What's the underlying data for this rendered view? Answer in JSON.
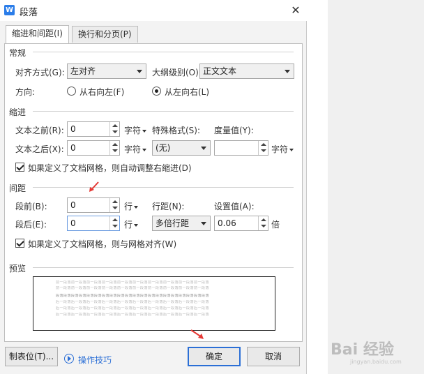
{
  "window": {
    "title": "段落",
    "app_icon": "W"
  },
  "tabs": [
    {
      "label": "缩进和间距(I)",
      "active": true
    },
    {
      "label": "换行和分页(P)",
      "active": false
    }
  ],
  "general": {
    "section_title": "常规",
    "alignment_label": "对齐方式(G):",
    "alignment_value": "左对齐",
    "outline_label": "大纲级别(O):",
    "outline_value": "正文文本",
    "direction_label": "方向:",
    "direction_rtl": "从右向左(F)",
    "direction_ltr": "从左向右(L)",
    "direction_selected": "ltr"
  },
  "indent": {
    "section_title": "缩进",
    "before_label": "文本之前(R):",
    "before_value": "0",
    "before_unit": "字符",
    "after_label": "文本之后(X):",
    "after_value": "0",
    "after_unit": "字符",
    "special_label": "特殊格式(S):",
    "special_value": "(无)",
    "measure_label": "度量值(Y):",
    "measure_value": "",
    "measure_unit": "字符",
    "auto_adjust_label": "如果定义了文档网格，则自动调整右缩进(D)",
    "auto_adjust_checked": true
  },
  "spacing": {
    "section_title": "间距",
    "before_label": "段前(B):",
    "before_value": "0",
    "before_unit": "行",
    "after_label": "段后(E):",
    "after_value": "0",
    "after_unit": "行",
    "line_label": "行距(N):",
    "line_value": "多倍行距",
    "setting_label": "设置值(A):",
    "setting_value": "0.06",
    "setting_unit": "倍",
    "snap_grid_label": "如果定义了文档网格，则与网格对齐(W)",
    "snap_grid_checked": true
  },
  "preview": {
    "section_title": "预览",
    "lines": [
      "前一段落前一段落前一段落前一段落前一段落前一段落前一段落前一段落前一段落前一段落",
      "前一段落前一段落前一段落前一段落前一段落前一段落前一段落前一段落前一段落前一段落",
      "段落段落段落段落段落段落段落段落段落段落段落段落段落段落段落段落段落段落段落段落",
      "后一段落后一段落后一段落后一段落后一段落后一段落后一段落后一段落后一段落后一段落",
      "后一段落后一段落后一段落后一段落后一段落后一段落后一段落后一段落后一段落后一段落",
      "后一段落后一段落后一段落后一段落后一段落后一段落后一段落后一段落后一段落后一段落"
    ]
  },
  "footer": {
    "tabs_button": "制表位(T)...",
    "tips_link": "操作技巧",
    "ok_button": "确定",
    "cancel_button": "取消"
  },
  "colors": {
    "accent": "#2b6fd6",
    "annotation_arrow": "#e53935",
    "dialog_bg": "#f3f3f3"
  },
  "watermark": {
    "text": "Bai 经验",
    "sub": "jingyan.baidu.com"
  }
}
